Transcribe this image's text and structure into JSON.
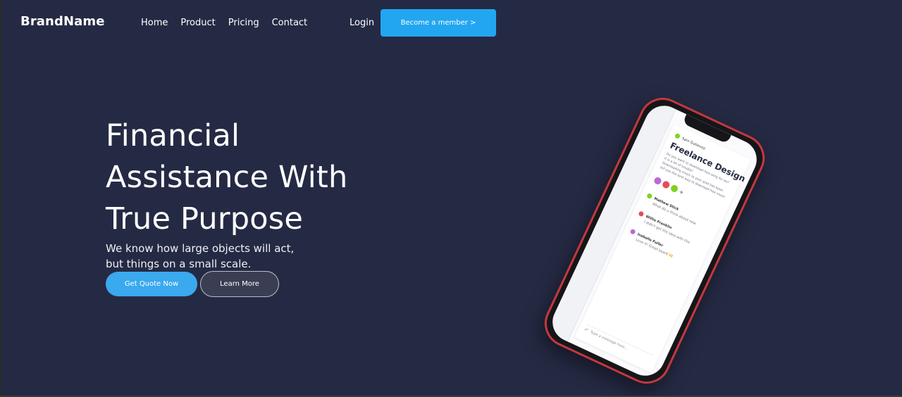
{
  "nav": {
    "brand": "BrandName",
    "links": [
      "Home",
      "Product",
      "Pricing",
      "Contact"
    ],
    "login": "Login",
    "member_button": "Become a member >"
  },
  "hero": {
    "title_lines": [
      "Financial",
      "Assistance With",
      "True Purpose"
    ],
    "subtitle_lines": [
      "We know how large objects will act,",
      "but things on a small scale."
    ],
    "primary_button": "Get Quote Now",
    "secondary_button": "Learn More"
  },
  "phone_screen": {
    "author": "Sam Gutierrez",
    "title": "Freelance Design",
    "body_lines": [
      "Do you want to download free song for ios?",
      "It is a lot of trouble!",
      "Downloading music to your ipod has been",
      "tell you the best way to download free music"
    ],
    "messages": [
      {
        "name": "Mathew Stick",
        "text": "What do u think about new"
      },
      {
        "name": "Willie Franklin",
        "text": "I didn't get the idea with the"
      },
      {
        "name": "Isabelle Fuller",
        "text": "Love it! Great board 🙌"
      }
    ],
    "input_placeholder": "Type a message here..."
  },
  "colors": {
    "background": "#252a44",
    "accent": "#23a6f0",
    "phone_frame": "#c4383d"
  }
}
